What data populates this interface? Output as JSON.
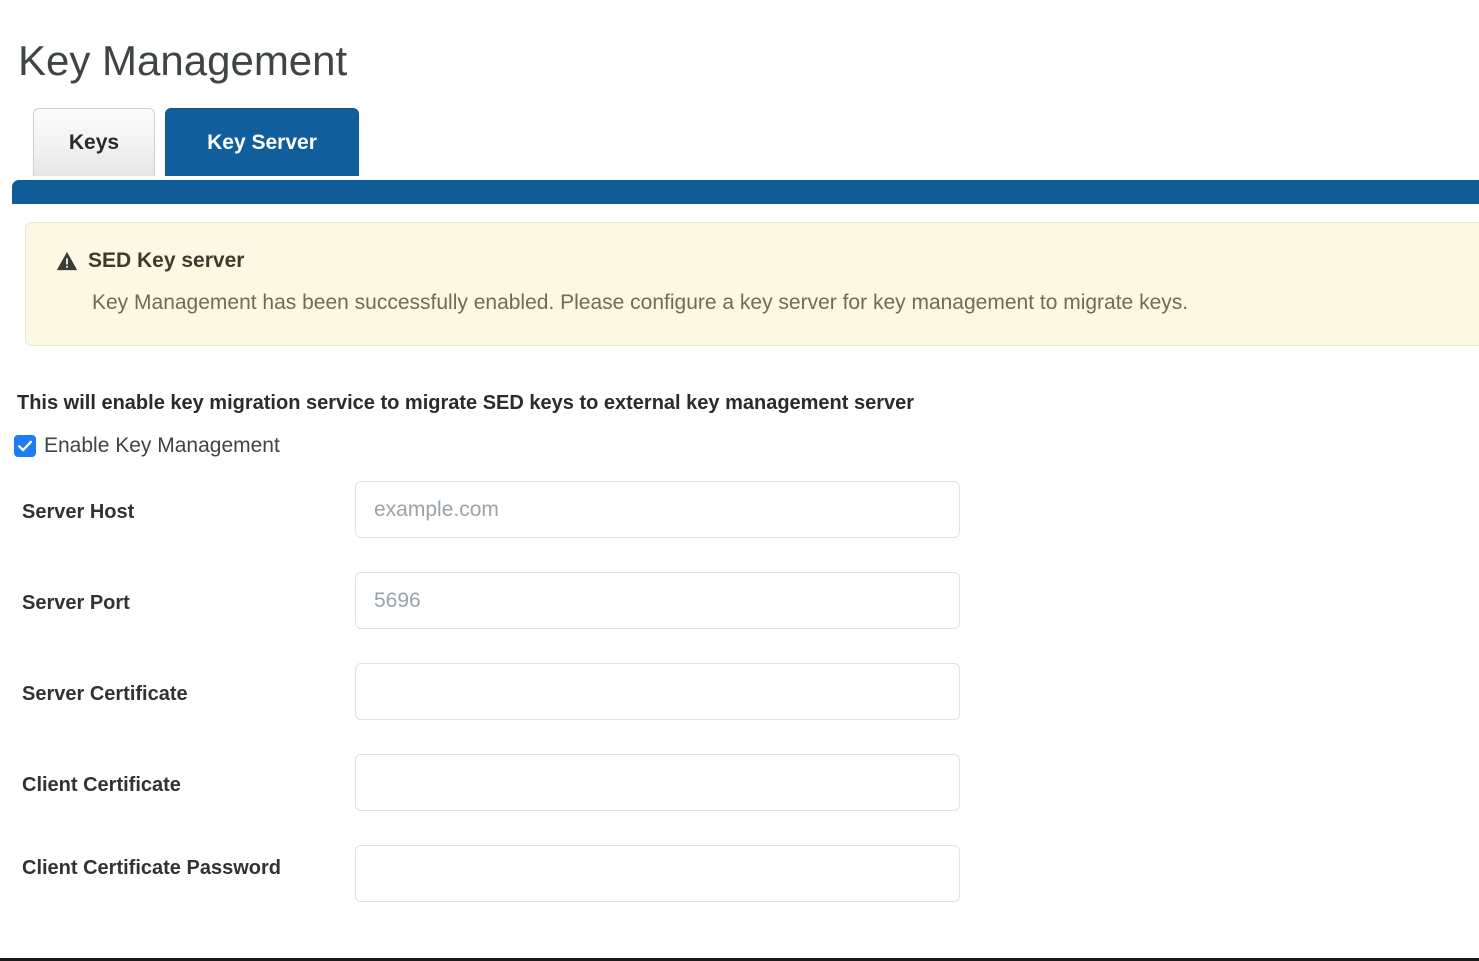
{
  "page": {
    "title": "Key Management"
  },
  "tabs": [
    {
      "id": "keys",
      "label": "Keys",
      "active": false
    },
    {
      "id": "key-server",
      "label": "Key Server",
      "active": true
    }
  ],
  "alert": {
    "icon": "warning-triangle-icon",
    "title": "SED Key server",
    "message": "Key Management has been successfully enabled. Please configure a key server for key management to migrate keys.",
    "background_color": "#fcf8e3",
    "border_color": "#ece7cd",
    "title_color": "#3d3b30",
    "text_color": "#756b50"
  },
  "form": {
    "heading": "This will enable key migration service to migrate SED keys to external key management server",
    "enable_checkbox": {
      "label": "Enable Key Management",
      "checked": true,
      "accent_color": "#1d7df4"
    },
    "fields": [
      {
        "id": "server-host",
        "label": "Server Host",
        "value": "",
        "placeholder": "example.com",
        "type": "text",
        "lines": 1
      },
      {
        "id": "server-port",
        "label": "Server Port",
        "value": "",
        "placeholder": "5696",
        "type": "text",
        "lines": 1
      },
      {
        "id": "server-certificate",
        "label": "Server Certificate",
        "value": "",
        "placeholder": "",
        "type": "text",
        "lines": 1
      },
      {
        "id": "client-certificate",
        "label": "Client Certificate",
        "value": "",
        "placeholder": "",
        "type": "text",
        "lines": 1
      },
      {
        "id": "client-certificate-password",
        "label": "Client Certificate Password",
        "value": "",
        "placeholder": "",
        "type": "password",
        "lines": 2
      }
    ]
  },
  "theme": {
    "accent_blue": "#0f5c98",
    "tab_active_bg": "#115e9c",
    "tab_inactive_bg": "#f2f2f2",
    "title_color": "#3f4447"
  }
}
